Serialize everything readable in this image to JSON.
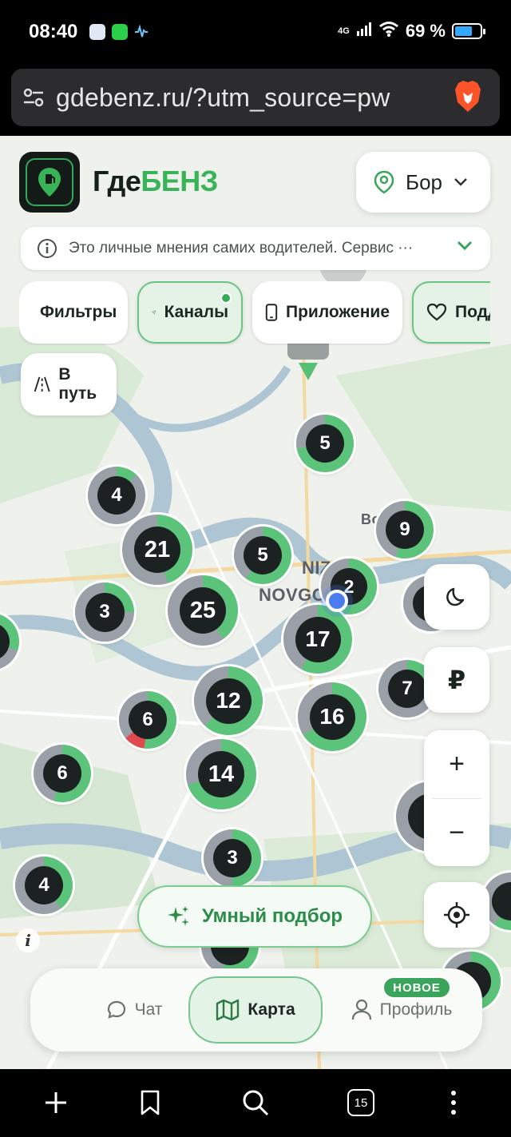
{
  "status_bar": {
    "time": "08:40",
    "network": "4G",
    "battery_percent": "69 %",
    "battery_level": 0.69
  },
  "browser": {
    "url": "gdebenz.ru/?utm_source=pw",
    "tabs_count": "15"
  },
  "header": {
    "brand_part1": "Где",
    "brand_part2": "БЕНЗ",
    "city": "Бор"
  },
  "notice": {
    "text": "Это личные мнения самих водителей. Сервис ···"
  },
  "chips": [
    {
      "label": "Фильтры"
    },
    {
      "label": "Каналы"
    },
    {
      "label": "Приложение"
    },
    {
      "label": "Подд"
    }
  ],
  "route_button": {
    "label": "В путь"
  },
  "map": {
    "labels": {
      "city_line1": "NIZH",
      "city_line2": "NOVGOROD",
      "area": "Bo"
    },
    "clusters": [
      "5",
      "4",
      "21",
      "5",
      "9",
      "3",
      "25",
      "2",
      "17",
      "7",
      "6",
      "12",
      "16",
      "6",
      "14",
      "3",
      "4"
    ]
  },
  "controls": {
    "currency": "₽",
    "zoom_in": "+",
    "zoom_out": "−"
  },
  "smart_pick": {
    "label": "Умный подбор"
  },
  "info": "i",
  "bottom_nav": {
    "chat": "Чат",
    "map": "Карта",
    "profile": "Профиль",
    "new_badge": "НОВОЕ"
  }
}
